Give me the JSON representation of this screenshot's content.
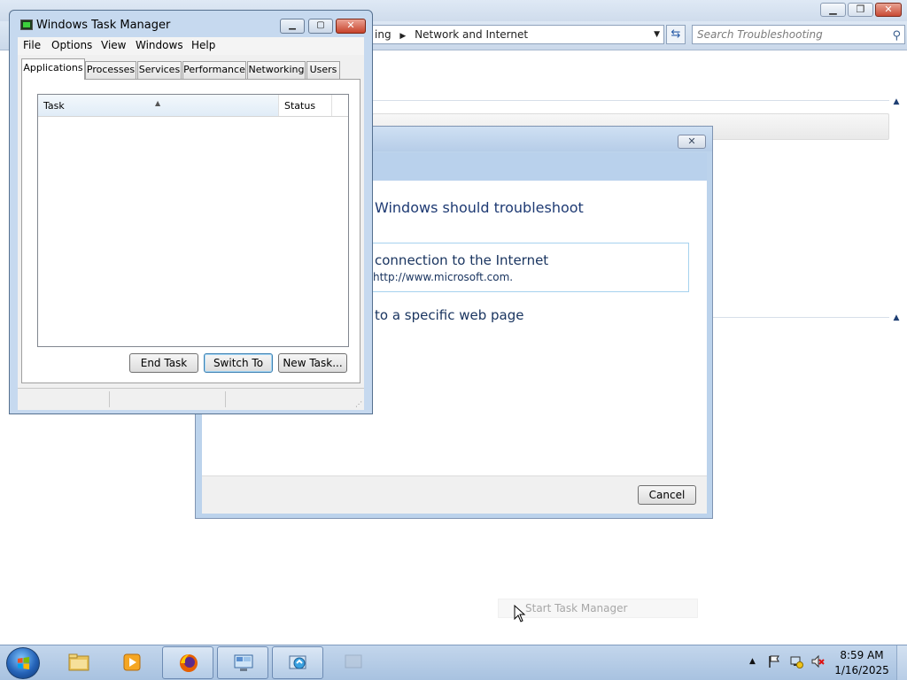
{
  "explorer": {
    "breadcrumb_prev": "ing",
    "breadcrumb_current": "Network and Internet",
    "search_placeholder": "Search Troubleshooting"
  },
  "troubleshooter": {
    "heading": "Windows should troubleshoot",
    "option1_title": "connection to the Internet",
    "option1_desc": "http://www.microsoft.com.",
    "option2_title": "to a specific web page",
    "cancel_label": "Cancel"
  },
  "task_manager": {
    "title": "Windows Task Manager",
    "menu": [
      "File",
      "Options",
      "View",
      "Windows",
      "Help"
    ],
    "tabs": [
      "Applications",
      "Processes",
      "Services",
      "Performance",
      "Networking",
      "Users"
    ],
    "active_tab": "Applications",
    "columns": [
      "Task",
      "Status"
    ],
    "buttons": [
      "End Task",
      "Switch To",
      "New Task..."
    ]
  },
  "context_item": {
    "label": "Start Task Manager"
  },
  "taskbar": {
    "pinned": [
      "windows-explorer",
      "media-player",
      "firefox",
      "remote-desktop",
      "troubleshooter"
    ],
    "clock_time": "8:59 AM",
    "clock_date": "1/16/2025"
  }
}
